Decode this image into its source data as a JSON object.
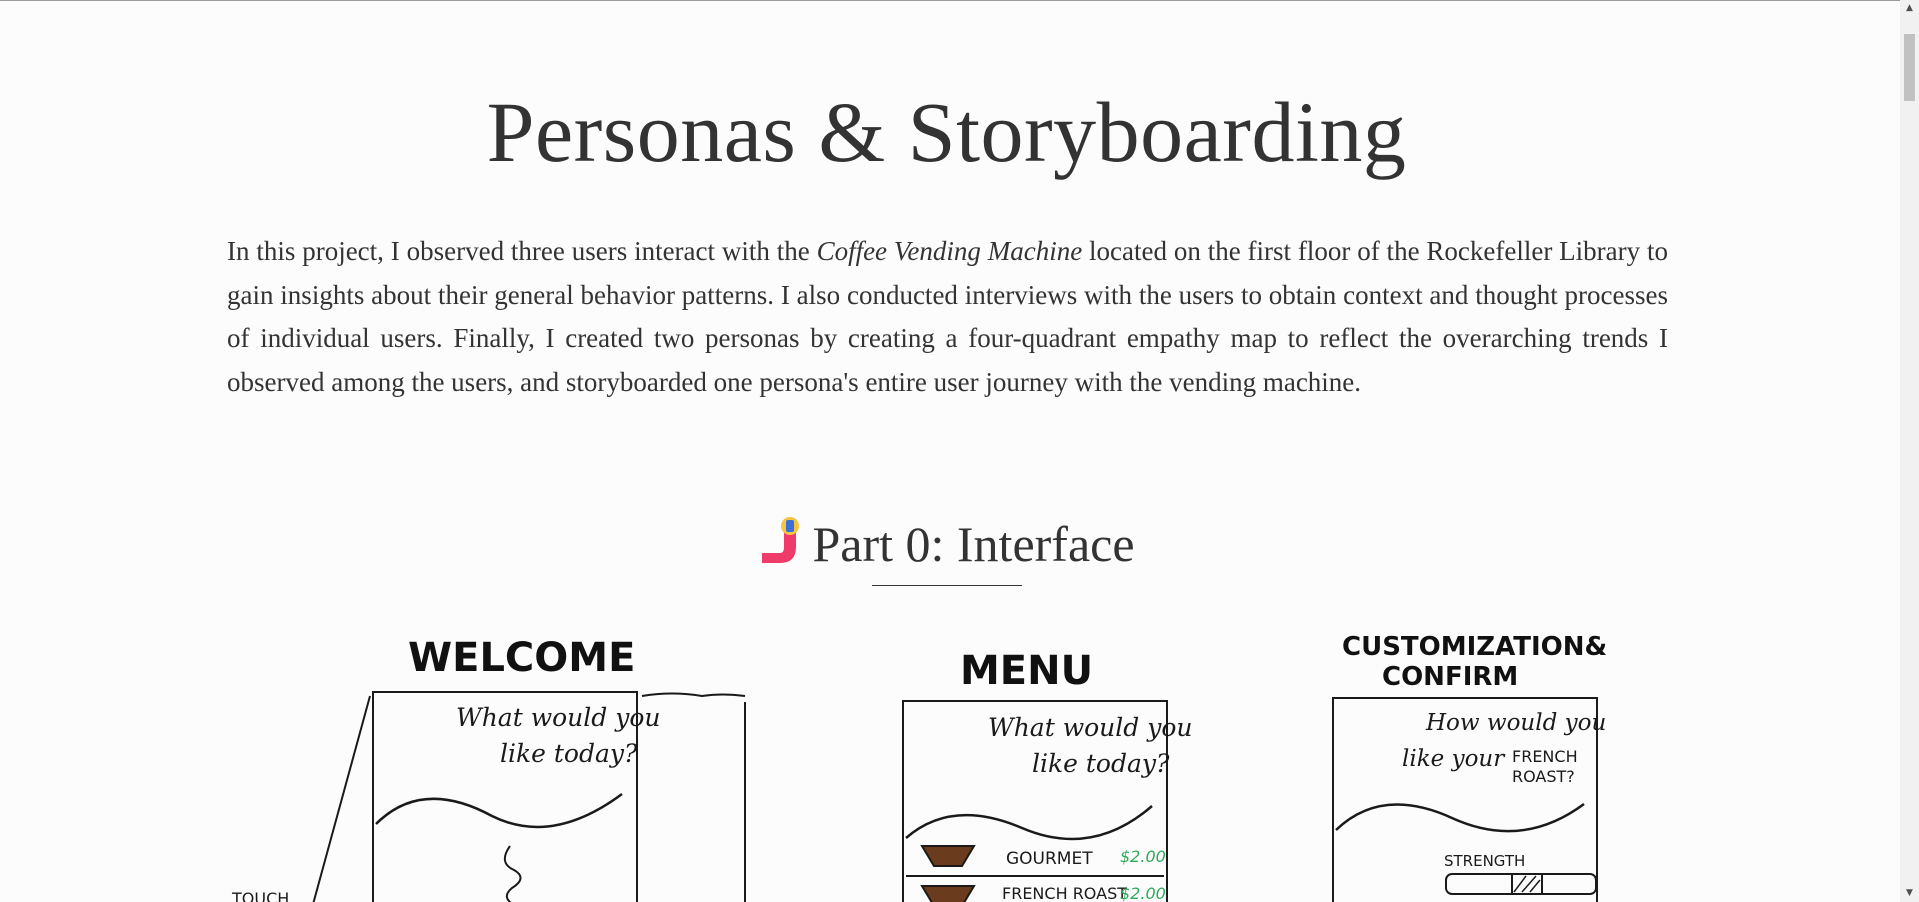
{
  "page": {
    "title": "Personas & Storyboarding",
    "intro": {
      "before_em": "In this project, I observed three users interact with the ",
      "em": "Coffee Vending Machine",
      "after_em": " located on the first floor of the Rockefeller Library to gain insights about their general behavior patterns. I also conducted interviews with the users to obtain context and thought processes of individual users. Finally, I created two personas by creating a four-quadrant empathy map to reflect the overarching trends I observed among the users, and storyboarded one persona's entire user journey with the vending machine."
    },
    "part0": {
      "emoji_icon": "j-emoji-icon",
      "heading": "Part 0: Interface"
    }
  },
  "sketches": {
    "welcome": {
      "title": "WELCOME",
      "prompt_line1": "What would you",
      "prompt_line2": "like today?",
      "side_label": "TOUCH"
    },
    "menu": {
      "title": "MENU",
      "prompt_line1": "What would you",
      "prompt_line2": "like today?",
      "items": [
        {
          "name": "GOURMET",
          "price": "$2.00"
        },
        {
          "name": "FRENCH ROAST",
          "price": "$2.00"
        }
      ]
    },
    "customize": {
      "title_line1": "CUSTOMIZATION&",
      "title_line2": "CONFIRM",
      "prompt_line1": "How would you",
      "prompt_line2": "like your",
      "prompt_line3": "FRENCH",
      "prompt_line4": "ROAST?",
      "slider_label": "STRENGTH"
    }
  },
  "colors": {
    "text": "#333333",
    "background": "#fdfcfc",
    "price_green": "#2eaa5a",
    "emoji_pink": "#ee3b6a",
    "emoji_yellow": "#f6c343"
  },
  "scrollbar": {
    "up_icon": "triangle-up-icon",
    "down_icon": "triangle-down-icon"
  }
}
